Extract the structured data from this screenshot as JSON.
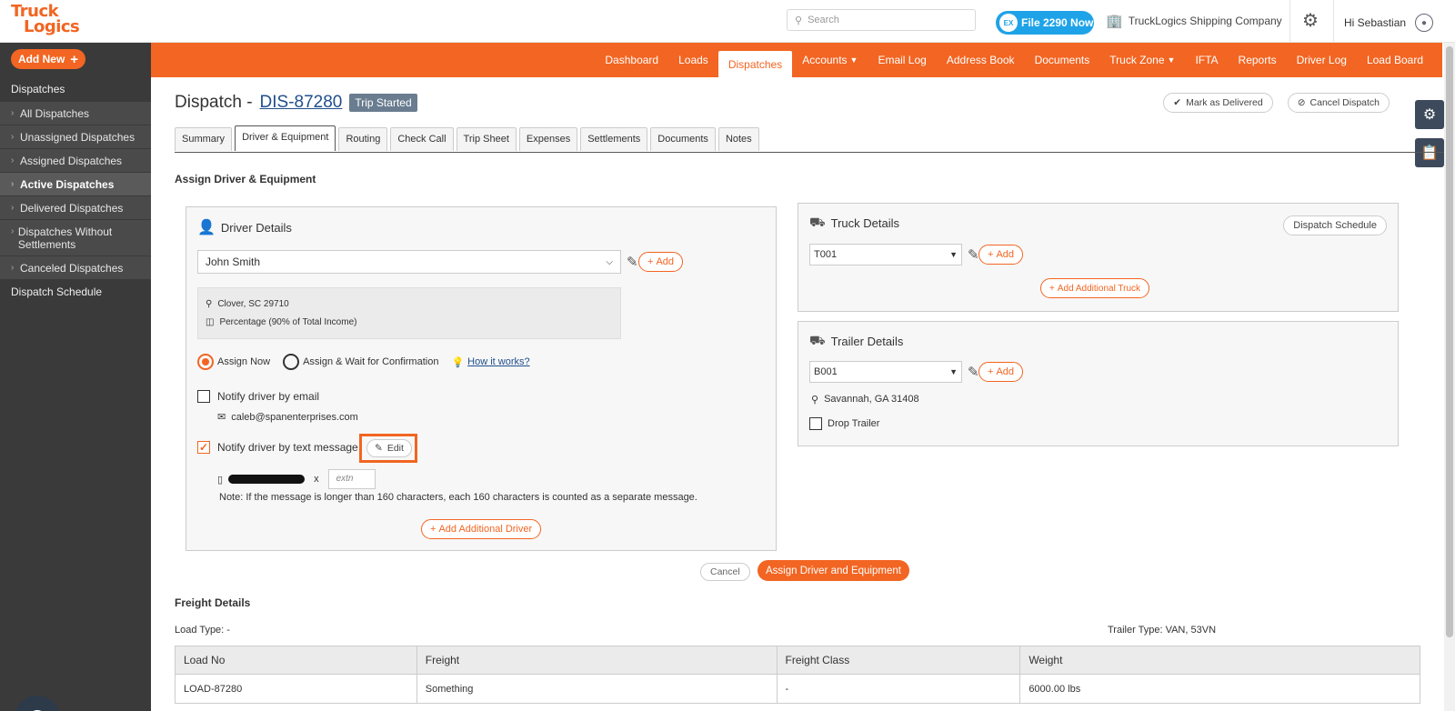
{
  "header": {
    "logo_line1": "Truck",
    "logo_line2": "Logics",
    "search_placeholder": "Search",
    "file2290_label": "File 2290 Now",
    "file2290_badge": "EX",
    "company": "TruckLogics Shipping Company",
    "greeting": "Hi Sebastian"
  },
  "sidebar": {
    "add_new": "Add New",
    "heading": "Dispatches",
    "items": [
      {
        "label": "All Dispatches",
        "active": false
      },
      {
        "label": "Unassigned Dispatches",
        "active": false
      },
      {
        "label": "Assigned Dispatches",
        "active": false
      },
      {
        "label": "Active Dispatches",
        "active": true
      },
      {
        "label": "Delivered Dispatches",
        "active": false
      },
      {
        "label": "Dispatches Without Settlements",
        "active": false
      },
      {
        "label": "Canceled Dispatches",
        "active": false
      }
    ],
    "schedule": "Dispatch Schedule"
  },
  "nav": {
    "items": [
      "Dashboard",
      "Loads",
      "Dispatches",
      "Accounts",
      "Email Log",
      "Address Book",
      "Documents",
      "Truck Zone",
      "IFTA",
      "Reports",
      "Driver Log",
      "Load Board"
    ],
    "active": "Dispatches",
    "dropdowns": [
      "Accounts",
      "Truck Zone"
    ]
  },
  "page": {
    "title_prefix": "Dispatch -",
    "dispatch_id": "DIS-87280",
    "status": "Trip Started",
    "mark_delivered": "Mark as Delivered",
    "cancel_dispatch": "Cancel Dispatch",
    "tabs": [
      "Summary",
      "Driver & Equipment",
      "Routing",
      "Check Call",
      "Trip Sheet",
      "Expenses",
      "Settlements",
      "Documents",
      "Notes"
    ],
    "active_tab": "Driver & Equipment",
    "section_title": "Assign Driver & Equipment"
  },
  "driver": {
    "heading": "Driver Details",
    "selected": "John Smith",
    "add_label": "Add",
    "location": "Clover, SC 29710",
    "pay": "Percentage (90% of Total Income)",
    "assign_now": "Assign Now",
    "assign_wait": "Assign & Wait for Confirmation",
    "how_it_works": "How it works?",
    "notify_email": "Notify driver by email",
    "email": "caleb@spanenterprises.com",
    "notify_text": "Notify driver by text message",
    "edit_label": "Edit",
    "ext_sep": "x",
    "extn_placeholder": "extn",
    "note": "Note: If the message is longer than 160 characters, each 160 characters is counted as a separate message.",
    "add_additional": "Add Additional Driver"
  },
  "truck": {
    "heading": "Truck Details",
    "schedule_btn": "Dispatch Schedule",
    "selected": "T001",
    "add_label": "Add",
    "add_additional": "Add Additional Truck"
  },
  "trailer": {
    "heading": "Trailer Details",
    "selected": "B001",
    "add_label": "Add",
    "location": "Savannah, GA 31408",
    "drop_trailer": "Drop Trailer"
  },
  "footer_actions": {
    "cancel": "Cancel",
    "assign": "Assign Driver and Equipment"
  },
  "freight": {
    "heading": "Freight Details",
    "load_type": "Load Type: -",
    "trailer_type": "Trailer Type: VAN, 53VN",
    "columns": [
      "Load No",
      "Freight",
      "Freight Class",
      "Weight"
    ],
    "rows": [
      [
        "LOAD-87280",
        "Something",
        "-",
        "6000.00 lbs"
      ]
    ]
  },
  "colors": {
    "accent": "#f26522",
    "sidebar": "#3a3a3a",
    "link": "#1f4f8c",
    "badge": "#1fa3e8"
  }
}
